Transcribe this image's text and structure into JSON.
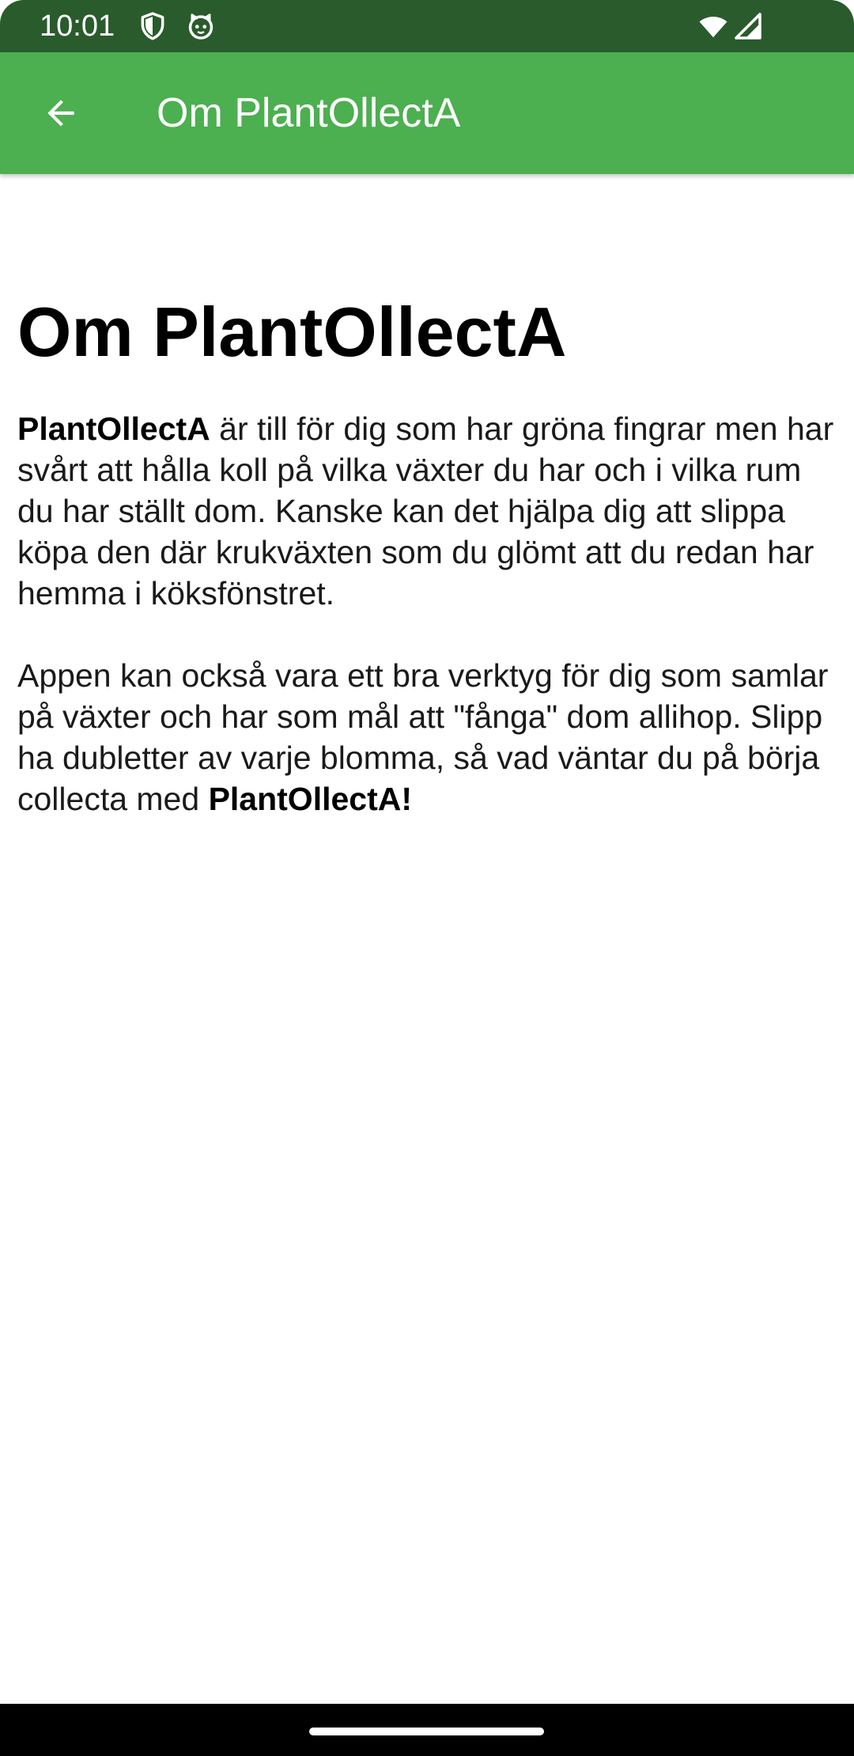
{
  "status_bar": {
    "time": "10:01",
    "icons": [
      "shield-icon",
      "cat-icon",
      "wifi-icon",
      "signal-icon"
    ]
  },
  "app_bar": {
    "title": "Om PlantOllectA",
    "back_icon": "arrow-back-icon"
  },
  "content": {
    "heading": "Om PlantOllectA",
    "paragraph1": {
      "bold_lead": "PlantOllectA",
      "text": " är till för dig som har gröna fingrar men har svårt att hålla koll på vilka växter du har och i vilka rum du har ställt dom. Kanske kan det hjälpa dig att slippa köpa den där krukväxten som du glömt att du redan har hemma i köksfönstret."
    },
    "paragraph2": {
      "text": "Appen kan också vara ett bra verktyg för dig som samlar på växter och har som mål att \"fånga\" dom allihop. Slipp ha dubletter av varje blomma, så vad väntar du på börja collecta med ",
      "bold_tail": "PlantOllectA!"
    }
  },
  "colors": {
    "status_bar": "#2a5b2c",
    "app_bar": "#4caf50",
    "background": "#ffffff",
    "nav_bar": "#000000"
  }
}
